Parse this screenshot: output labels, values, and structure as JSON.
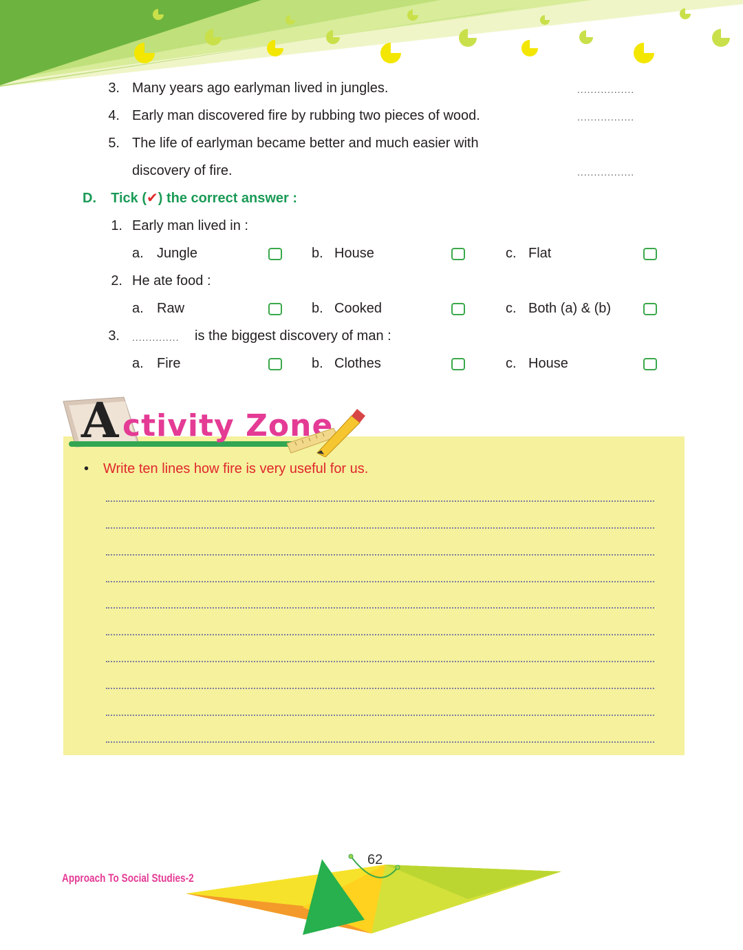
{
  "true_false_items": [
    {
      "num": "3.",
      "line1": "Many years ago earlyman lived in jungles.",
      "answer_blank": "................."
    },
    {
      "num": "4.",
      "line1": "Early man discovered fire by rubbing two pieces of wood.",
      "answer_blank": "................."
    },
    {
      "num": "5.",
      "line1": "The life of earlyman became better and much easier with",
      "line2": "discovery of fire.",
      "answer_blank": "................."
    }
  ],
  "section_d": {
    "letter": "D.",
    "heading_pre": "Tick (",
    "tick_mark": "✔",
    "heading_post": ") the correct answer :",
    "questions": [
      {
        "num": "1.",
        "text": "Early man lived in :",
        "options": [
          {
            "letter": "a.",
            "label": "Jungle"
          },
          {
            "letter": "b.",
            "label": "House"
          },
          {
            "letter": "c.",
            "label": "Flat"
          }
        ]
      },
      {
        "num": "2.",
        "text": "He ate food :",
        "options": [
          {
            "letter": "a.",
            "label": "Raw"
          },
          {
            "letter": "b.",
            "label": "Cooked"
          },
          {
            "letter": "c.",
            "label": "Both (a) & (b)"
          }
        ]
      },
      {
        "num": "3.",
        "blank": "..............",
        "text": "is the biggest discovery of man :",
        "options": [
          {
            "letter": "a.",
            "label": "Fire"
          },
          {
            "letter": "b.",
            "label": "Clothes"
          },
          {
            "letter": "c.",
            "label": "House"
          }
        ]
      }
    ]
  },
  "activity_zone": {
    "title_initial": "A",
    "title_rest": "ctivity Zone",
    "bullet": "•",
    "prompt": "Write ten lines how fire is very useful for us."
  },
  "footer": {
    "book_title": "Approach To Social Studies-2",
    "page_number": "62"
  },
  "colors": {
    "section_heading": "#1a9a56",
    "tick": "#e22b2b",
    "prompt": "#e0262b",
    "activity_bg": "#f5f19d",
    "title_pink": "#e43b95",
    "checkbox_border": "#3aa84a"
  }
}
